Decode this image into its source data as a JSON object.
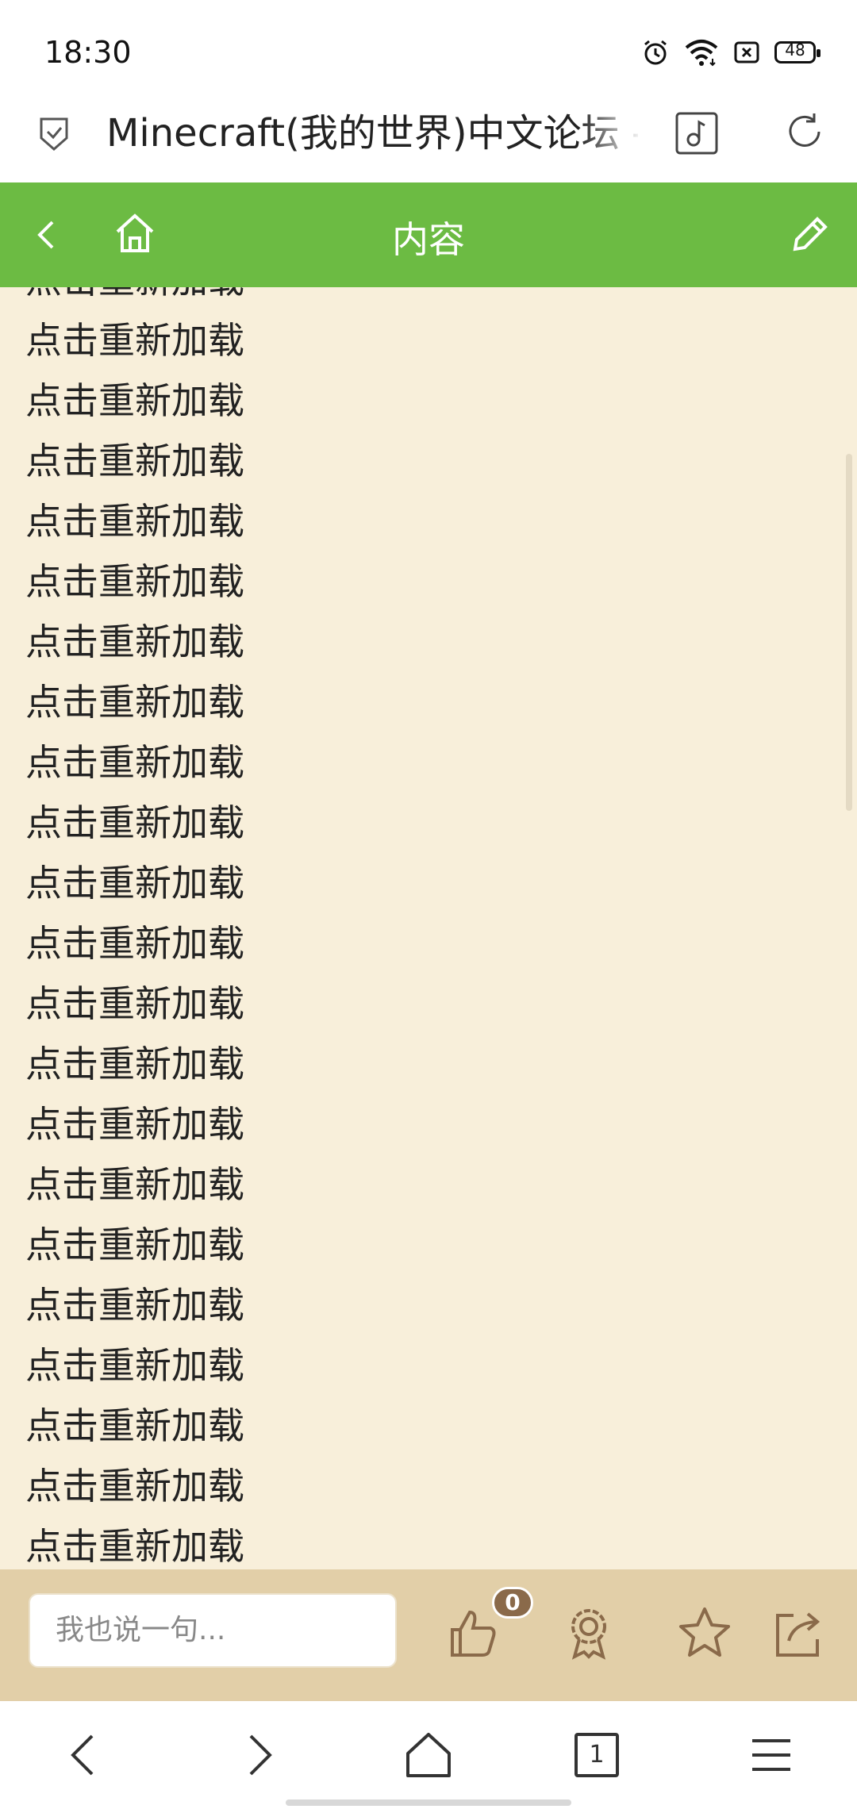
{
  "status_bar": {
    "time": "18:30",
    "battery": "48",
    "icons": [
      "alarm-icon",
      "wifi-icon",
      "sim-off-icon",
      "battery-icon"
    ]
  },
  "browser": {
    "page_title": "Minecraft(我的世界)中文论坛 - 手",
    "icons": [
      "shield-icon",
      "music-icon",
      "reload-icon"
    ]
  },
  "header": {
    "title": "内容",
    "icons": [
      "back-icon",
      "home-icon",
      "edit-icon"
    ]
  },
  "content": {
    "items": [
      "点击重新加载",
      "点击重新加载",
      "点击重新加载",
      "点击重新加载",
      "点击重新加载",
      "点击重新加载",
      "点击重新加载",
      "点击重新加载",
      "点击重新加载",
      "点击重新加载",
      "点击重新加载",
      "点击重新加载",
      "点击重新加载",
      "点击重新加载",
      "点击重新加载",
      "点击重新加载",
      "点击重新加载",
      "点击重新加载",
      "点击重新加载",
      "点击重新加载",
      "点击重新加载",
      "点击重新加载"
    ]
  },
  "comment_bar": {
    "placeholder": "我也说一句...",
    "like_count": "0",
    "icons": [
      "thumbs-up-icon",
      "award-icon",
      "star-icon",
      "share-icon"
    ]
  },
  "nav_bar": {
    "tab_count": "1",
    "icons": [
      "nav-back-icon",
      "nav-forward-icon",
      "nav-home-icon",
      "tabs-icon",
      "menu-icon"
    ]
  },
  "colors": {
    "header_green": "#6cbb43",
    "content_bg": "#f8efda",
    "toolbar_bg": "#e2cfa8",
    "icon_brown": "#8a6a4a"
  }
}
